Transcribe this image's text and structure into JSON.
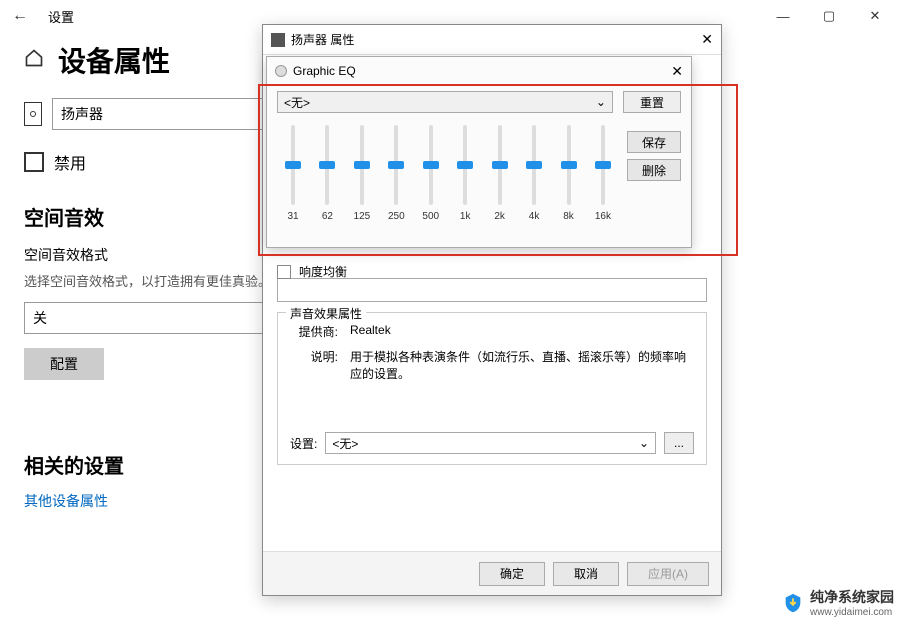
{
  "settings": {
    "window_title": "设置",
    "page_title": "设备属性",
    "device_name": "扬声器",
    "disable_label": "禁用",
    "spatial_heading": "空间音效",
    "spatial_format_label": "空间音效格式",
    "spatial_help": "选择空间音效格式，以打造拥有更佳真验。",
    "spatial_value": "关",
    "configure_btn": "配置",
    "related_heading": "相关的设置",
    "related_link": "其他设备属性"
  },
  "speaker_dialog": {
    "title": "扬声器 属性",
    "loudness_label": "响度均衡",
    "effect_group": "声音效果属性",
    "provider_label": "提供商:",
    "provider_value": "Realtek",
    "desc_label": "说明:",
    "desc_value": "用于模拟各种表演条件（如流行乐、直播、摇滚乐等）的频率响应的设置。",
    "setting_label": "设置:",
    "setting_value": "<无>",
    "more_btn": "...",
    "ok_btn": "确定",
    "cancel_btn": "取消",
    "apply_btn": "应用(A)"
  },
  "eq_dialog": {
    "title": "Graphic EQ",
    "preset_value": "<无>",
    "reset_btn": "重置",
    "save_btn": "保存",
    "delete_btn": "删除",
    "freqs": [
      "31",
      "62",
      "125",
      "250",
      "500",
      "1k",
      "2k",
      "4k",
      "8k",
      "16k"
    ]
  },
  "watermark": {
    "text": "纯净系统家园",
    "url": "www.yidaimei.com"
  }
}
